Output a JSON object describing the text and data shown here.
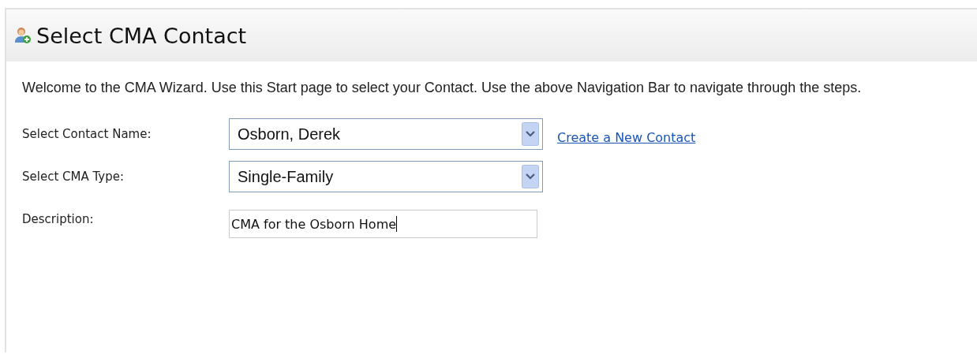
{
  "header": {
    "title": "Select CMA Contact"
  },
  "intro": "Welcome to the CMA Wizard. Use this Start page to select your Contact. Use the above Navigation Bar to navigate through the steps.",
  "fields": [
    {
      "kind": "select",
      "label": "Select Contact Name:",
      "value": "Osborn, Derek",
      "link": "Create a New Contact"
    },
    {
      "kind": "select",
      "label": "Select CMA Type:",
      "value": "Single-Family"
    },
    {
      "kind": "text",
      "label": "Description:",
      "value": "CMA for the Osborn Home"
    }
  ]
}
